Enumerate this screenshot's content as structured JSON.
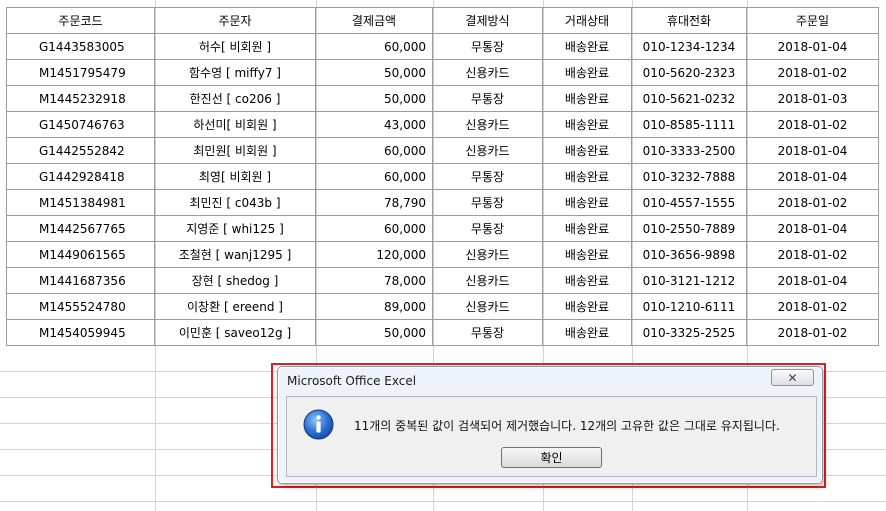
{
  "table": {
    "headers": [
      "주문코드",
      "주문자",
      "결제금액",
      "결제방식",
      "거래상태",
      "휴대전화",
      "주문일"
    ],
    "rows": [
      [
        "G1443583005",
        "허수[ 비회원 ]",
        "60,000",
        "무통장",
        "배송완료",
        "010-1234-1234",
        "2018-01-04"
      ],
      [
        "M1451795479",
        "함수영 [ miffy7 ]",
        "50,000",
        "신용카드",
        "배송완료",
        "010-5620-2323",
        "2018-01-02"
      ],
      [
        "M1445232918",
        "한진선 [ co206 ]",
        "50,000",
        "무통장",
        "배송완료",
        "010-5621-0232",
        "2018-01-03"
      ],
      [
        "G1450746763",
        "하선미[ 비회원 ]",
        "43,000",
        "신용카드",
        "배송완료",
        "010-8585-1111",
        "2018-01-02"
      ],
      [
        "G1442552842",
        "최민원[ 비회원 ]",
        "60,000",
        "신용카드",
        "배송완료",
        "010-3333-2500",
        "2018-01-04"
      ],
      [
        "G1442928418",
        "최영[ 비회원 ]",
        "60,000",
        "무통장",
        "배송완료",
        "010-3232-7888",
        "2018-01-04"
      ],
      [
        "M1451384981",
        "최민진 [ c043b ]",
        "78,790",
        "무통장",
        "배송완료",
        "010-4557-1555",
        "2018-01-02"
      ],
      [
        "M1442567765",
        "지영준 [ whi125 ]",
        "60,000",
        "무통장",
        "배송완료",
        "010-2550-7889",
        "2018-01-04"
      ],
      [
        "M1449061565",
        "조철현 [ wanj1295 ]",
        "120,000",
        "신용카드",
        "배송완료",
        "010-3656-9898",
        "2018-01-02"
      ],
      [
        "M1441687356",
        "장현 [ shedog ]",
        "78,000",
        "신용카드",
        "배송완료",
        "010-3121-1212",
        "2018-01-04"
      ],
      [
        "M1455524780",
        "이창환 [ ereend ]",
        "89,000",
        "신용카드",
        "배송완료",
        "010-1210-6111",
        "2018-01-02"
      ],
      [
        "M1454059945",
        "이민훈 [ saveo12g ]",
        "50,000",
        "무통장",
        "배송완료",
        "010-3325-2525",
        "2018-01-02"
      ]
    ]
  },
  "dialog": {
    "title": "Microsoft Office Excel",
    "close_label": "✕",
    "icon": "info-icon",
    "message": "11개의 중복된 값이 검색되어 제거했습니다. 12개의 고유한 값은 그대로 유지됩니다.",
    "ok_label": "확인"
  },
  "colors": {
    "highlight_frame": "#e02020",
    "icon_blue": "#1f5fbf"
  }
}
